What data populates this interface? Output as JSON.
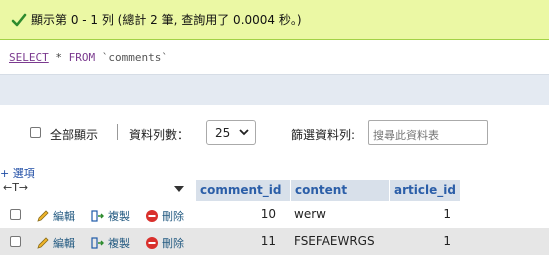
{
  "success": {
    "message": "顯示第 0 - 1 列 (總計 2 筆, 查詢用了 0.0004 秒。)"
  },
  "sql": {
    "select": "SELECT",
    "star": "*",
    "from": "FROM",
    "table": "`comments`"
  },
  "controls": {
    "show_all_label": "全部顯示",
    "rows_label": "資料列數：",
    "rows_value": "25",
    "filter_label": "篩選資料列:",
    "filter_placeholder": "搜尋此資料表"
  },
  "options_label": "+ 選項",
  "arrows_label": "←T→",
  "columns": [
    "comment_id",
    "content",
    "article_id"
  ],
  "row_actions": {
    "edit": "編輯",
    "copy": "複製",
    "delete": "刪除"
  },
  "rows": [
    {
      "comment_id": "10",
      "content": "werw",
      "article_id": "1"
    },
    {
      "comment_id": "11",
      "content": "FSEFAEWRGS",
      "article_id": "1"
    }
  ],
  "colors": {
    "success_bg": "#ebf8a4",
    "header_bg": "#d8e0ea",
    "link": "#235a81"
  }
}
